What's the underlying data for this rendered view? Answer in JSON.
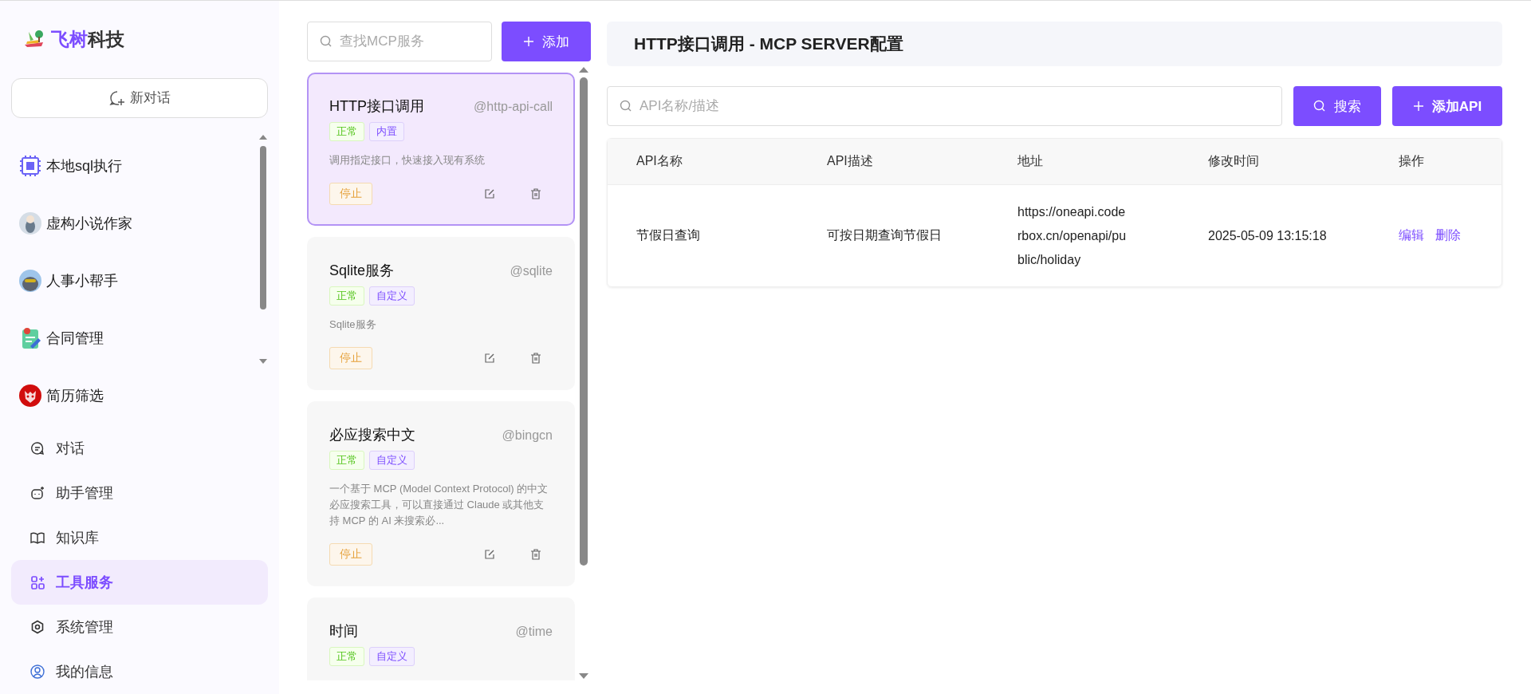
{
  "brand": {
    "name_part1": "飞树",
    "name_part2": "科技"
  },
  "new_chat": {
    "label": "新对话"
  },
  "assistants": [
    {
      "label": "本地sql执行"
    },
    {
      "label": "虚构小说作家"
    },
    {
      "label": "人事小帮手"
    },
    {
      "label": "合同管理"
    },
    {
      "label": "简历筛选"
    }
  ],
  "menu": [
    {
      "label": "对话",
      "selected": false
    },
    {
      "label": "助手管理",
      "selected": false
    },
    {
      "label": "知识库",
      "selected": false
    },
    {
      "label": "工具服务",
      "selected": true
    },
    {
      "label": "系统管理",
      "selected": false
    },
    {
      "label": "我的信息",
      "selected": false
    }
  ],
  "service_search": {
    "placeholder": "查找MCP服务"
  },
  "add_button": {
    "label": "添加"
  },
  "services": [
    {
      "name": "HTTP接口调用",
      "handle": "@http-api-call",
      "selected": true,
      "tags": [
        {
          "label": "正常",
          "kind": "status"
        },
        {
          "label": "内置",
          "kind": "type"
        }
      ],
      "description": "调用指定接口，快速接入现有系统",
      "stop_label": "停止"
    },
    {
      "name": "Sqlite服务",
      "handle": "@sqlite",
      "selected": false,
      "tags": [
        {
          "label": "正常",
          "kind": "status"
        },
        {
          "label": "自定义",
          "kind": "type"
        }
      ],
      "description": "Sqlite服务",
      "stop_label": "停止"
    },
    {
      "name": "必应搜索中文",
      "handle": "@bingcn",
      "selected": false,
      "tags": [
        {
          "label": "正常",
          "kind": "status"
        },
        {
          "label": "自定义",
          "kind": "type"
        }
      ],
      "description": "一个基于 MCP (Model Context Protocol) 的中文必应搜索工具，可以直接通过 Claude 或其他支持 MCP 的 AI 来搜索必...",
      "stop_label": "停止"
    },
    {
      "name": "时间",
      "handle": "@time",
      "selected": false,
      "tags": [
        {
          "label": "正常",
          "kind": "status"
        },
        {
          "label": "自定义",
          "kind": "type"
        }
      ]
    }
  ],
  "detail": {
    "title": "HTTP接口调用 - MCP SERVER配置",
    "search": {
      "placeholder": "API名称/描述"
    },
    "search_button": "搜索",
    "add_api_button": "添加API",
    "table": {
      "columns": [
        "API名称",
        "API描述",
        "地址",
        "修改时间",
        "操作"
      ],
      "rows": [
        {
          "cells": [
            "节假日查询",
            "可按日期查询节假日",
            "https://oneapi.coderbox.cn/openapi/public/holiday",
            "2025-05-09 13:15:18"
          ],
          "actions": [
            "编辑",
            "删除"
          ]
        }
      ]
    }
  }
}
